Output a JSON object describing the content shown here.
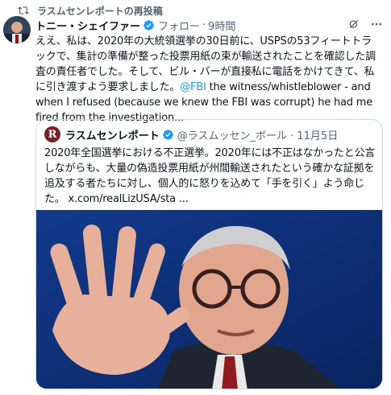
{
  "repost": {
    "icon": "repost-icon",
    "text": "ラスムセンレポートの再投稿"
  },
  "post": {
    "author_name": "トニー・シェイファー",
    "separator": "·",
    "follow_label": "フォロー",
    "time": "9時間",
    "body_ja": "ええ、私は、2020年の大統領選挙の30日前に、USPSの53フィートトラックで、集計の準備が整った投票用紙の束が輸送されたことを確認した調査の責任者でした。そして、ビル・バーが直接私に電話をかけてきて、私に引き渡すよう要求しました。",
    "mention": "@FBI",
    "body_en": " the witness/whistleblower - and when I refused (because we knew the FBI was corrupt) he had me fired from the investigation..."
  },
  "quote": {
    "logo_letter": "R",
    "name": "ラスムセンレポート",
    "handle": "@ラスムッセン_ボール · 11月5日",
    "text": "2020年全国選挙における不正選挙。2020年には不正はなかったと公言しながらも、大量の偽造投票用紙が州間輸送されたという確かな証拠を追及する者たちに対し、個人的に怒りを込めて「手を引く」よう命じた。 x.com/realLizUSA/sta ..."
  },
  "colors": {
    "accent": "#1d9bf0",
    "secondary_text": "#536471",
    "border": "#cfd9de"
  }
}
